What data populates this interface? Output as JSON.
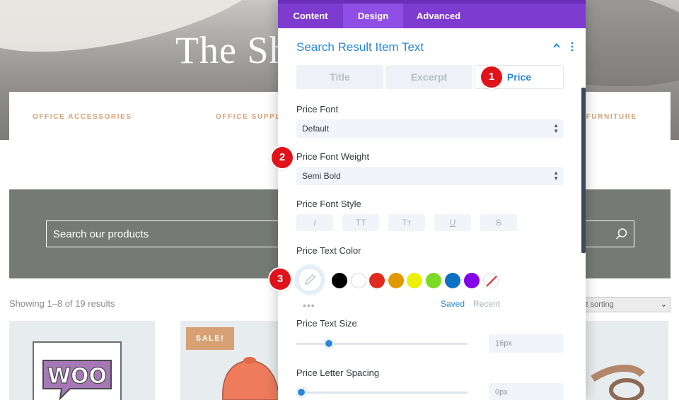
{
  "background": {
    "hero_title": "The Sh",
    "nav": [
      "OFFICE ACCESSORIES",
      "OFFICE SUPPLI",
      "E FURNITURE"
    ],
    "search": {
      "placeholder": "Search our products"
    },
    "result_count": "Showing 1–8 of 19 results",
    "sorting": {
      "selected": "ult sorting"
    },
    "products": [
      {
        "badge": "SALE!"
      }
    ]
  },
  "panel": {
    "tabs": [
      {
        "label": "Content"
      },
      {
        "label": "Design"
      },
      {
        "label": "Advanced"
      }
    ],
    "active_tab": "Design",
    "section_title": "Search Result Item Text",
    "subtabs": [
      {
        "label": "Title"
      },
      {
        "label": "Excerpt"
      },
      {
        "label": "Price"
      }
    ],
    "active_subtab": "Price",
    "price_font": {
      "label": "Price Font",
      "value": "Default"
    },
    "price_font_weight": {
      "label": "Price Font Weight",
      "value": "Semi Bold"
    },
    "price_font_style": {
      "label": "Price Font Style",
      "buttons": [
        {
          "glyph": "I",
          "icon": "italic-icon"
        },
        {
          "glyph": "TT",
          "icon": "uppercase-icon"
        },
        {
          "glyph": "Tт",
          "icon": "capitalize-icon"
        },
        {
          "glyph": "U",
          "icon": "underline-icon"
        },
        {
          "glyph": "S",
          "icon": "strikethrough-icon"
        }
      ]
    },
    "price_text_color": {
      "label": "Price Text Color",
      "swatches": [
        "#000000",
        "#ffffff",
        "#e02b20",
        "#e09900",
        "#edf000",
        "#7cda24",
        "#0c71c3",
        "#8300e9",
        "transparent"
      ],
      "saved_label": "Saved",
      "recent_label": "Recent",
      "more_label": "•••"
    },
    "price_text_size": {
      "label": "Price Text Size",
      "value": "16px",
      "level": 0.17
    },
    "price_letter_spacing": {
      "label": "Price Letter Spacing",
      "value": "0px",
      "level": 0.0
    }
  },
  "markers": [
    {
      "number": "1"
    },
    {
      "number": "2"
    },
    {
      "number": "3"
    }
  ],
  "colors": {
    "panel_tab_bar": "#7e3bd0",
    "panel_tab_active": "#8f4ee4",
    "accent_blue": "#2b87da",
    "marker_red": "#e0121a",
    "shop_accent": "#d7a175",
    "search_band": "#757b74"
  }
}
